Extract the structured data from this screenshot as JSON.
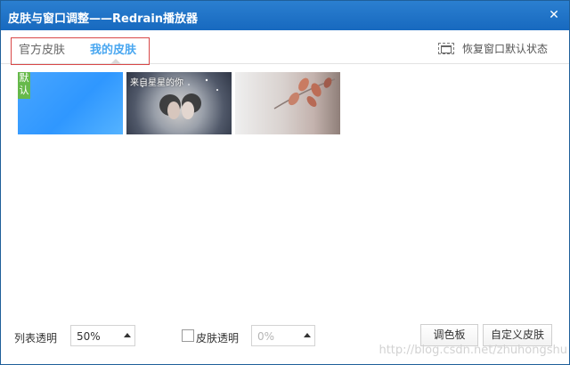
{
  "window": {
    "title": "皮肤与窗口调整——Redrain播放器",
    "close_icon": "close-icon"
  },
  "tabs": [
    {
      "label": "官方皮肤",
      "active": false
    },
    {
      "label": "我的皮肤",
      "active": true
    }
  ],
  "header_actions": {
    "restore_label": "恢复窗口默认状态",
    "restore_icon": "window-restore-icon"
  },
  "skins": [
    {
      "name": "默认",
      "default": true,
      "accent": "#3a9cff"
    },
    {
      "name": "来自星星的你",
      "default": false,
      "accent": "#495266"
    },
    {
      "name": "",
      "default": false,
      "accent": "#c9b8b2"
    }
  ],
  "controls": {
    "list_opacity_label": "列表透明",
    "list_opacity_value": "50%",
    "skin_opacity_label": "皮肤透明",
    "skin_opacity_value": "0%",
    "skin_opacity_checked": false,
    "palette_button": "调色板",
    "custom_skin_button": "自定义皮肤"
  },
  "watermark": "http://blog.csdn.net/zhuhongshu",
  "colors": {
    "titlebar": "#1f6fc5",
    "active_tab": "#4aa7f0",
    "highlight_box": "#d94848",
    "default_badge": "#66b94b"
  }
}
